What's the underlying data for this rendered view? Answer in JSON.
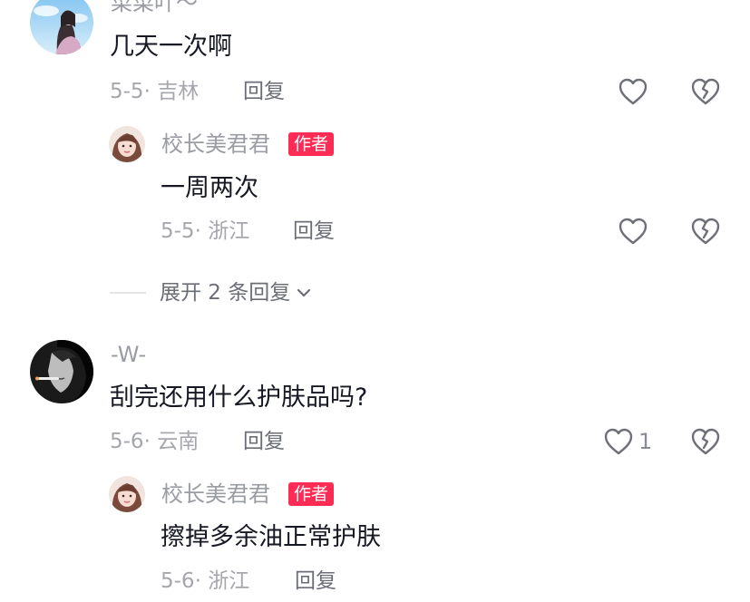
{
  "comments": [
    {
      "username": "菜菜吖～",
      "text": "几天一次啊",
      "date_location": "5-5· 吉林",
      "reply_label": "回复",
      "reply": {
        "username": "校长美君君",
        "badge": "作者",
        "text": "一周两次",
        "date_location": "5-5· 浙江",
        "reply_label": "回复"
      },
      "expand_label": "展开 2 条回复"
    },
    {
      "username": "-W-",
      "text": "刮完还用什么护肤品吗?",
      "date_location": "5-6· 云南",
      "reply_label": "回复",
      "like_count": "1",
      "reply": {
        "username": "校长美君君",
        "badge": "作者",
        "text": "擦掉多余油正常护肤",
        "date_location": "5-6· 浙江",
        "reply_label": "回复"
      }
    }
  ],
  "icons": {
    "like": "heart-outline-icon",
    "dislike": "broken-heart-icon",
    "expand": "chevron-down-icon"
  },
  "colors": {
    "badge": "#fe2c55",
    "username": "#9a9ca3",
    "text": "#161823",
    "meta": "#a5a7ad",
    "icon": "#6e7078"
  }
}
